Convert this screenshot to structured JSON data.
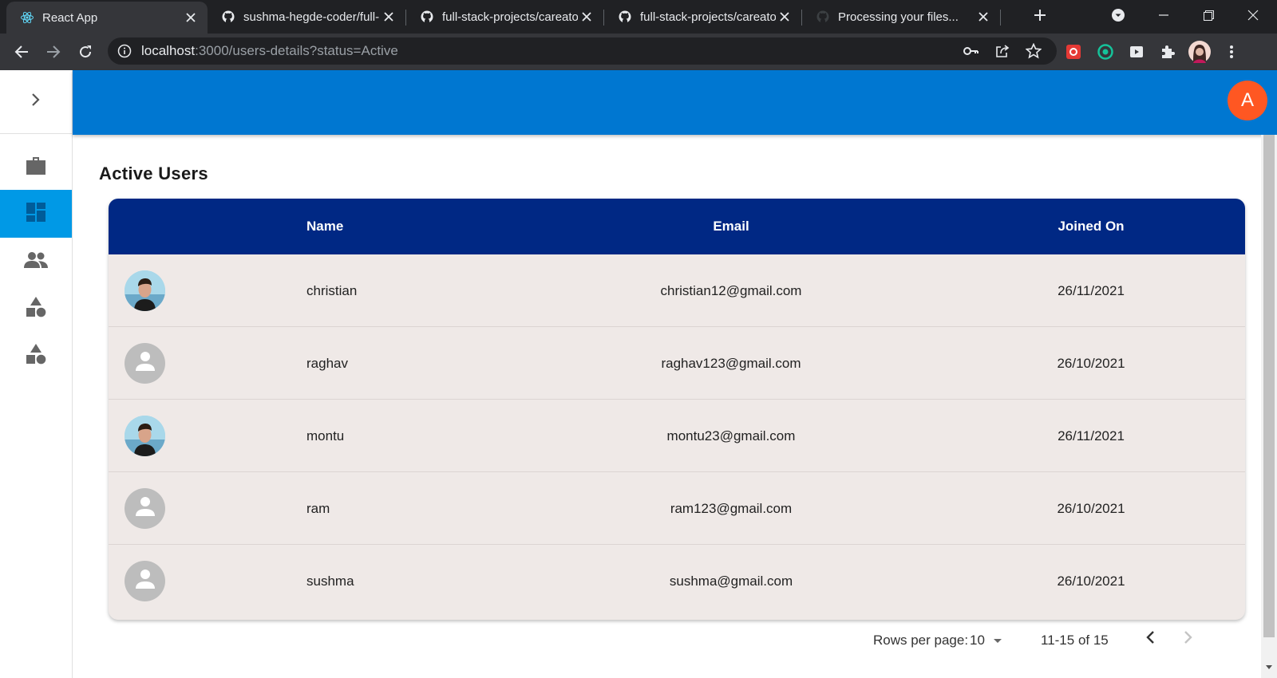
{
  "browser": {
    "tabs": [
      {
        "title": "React App",
        "active": true
      },
      {
        "title": "sushma-hegde-coder/full-",
        "active": false
      },
      {
        "title": "full-stack-projects/careato",
        "active": false
      },
      {
        "title": "full-stack-projects/careato",
        "active": false
      },
      {
        "title": "Processing your files...",
        "active": false
      }
    ],
    "url_host": "localhost",
    "url_rest": ":3000/users-details?status=Active"
  },
  "appbar": {
    "avatar_letter": "A"
  },
  "page": {
    "title": "Active Users"
  },
  "table": {
    "headers": {
      "name": "Name",
      "email": "Email",
      "joined": "Joined On"
    },
    "rows": [
      {
        "name": "christian",
        "email": "christian12@gmail.com",
        "joined": "26/11/2021",
        "avatar": "photo"
      },
      {
        "name": "raghav",
        "email": "raghav123@gmail.com",
        "joined": "26/10/2021",
        "avatar": "default"
      },
      {
        "name": "montu",
        "email": "montu23@gmail.com",
        "joined": "26/11/2021",
        "avatar": "photo"
      },
      {
        "name": "ram",
        "email": "ram123@gmail.com",
        "joined": "26/10/2021",
        "avatar": "default"
      },
      {
        "name": "sushma",
        "email": "sushma@gmail.com",
        "joined": "26/10/2021",
        "avatar": "default"
      }
    ]
  },
  "pagination": {
    "rows_per_page_label": "Rows per page:",
    "rows_per_page_value": "10",
    "range": "11-15 of 15"
  },
  "colors": {
    "appbar": "#0077d1",
    "sidebar_active": "#0099e6",
    "table_header": "#002884",
    "table_body": "#efe9e7",
    "avatar_accent": "#ff5722"
  }
}
